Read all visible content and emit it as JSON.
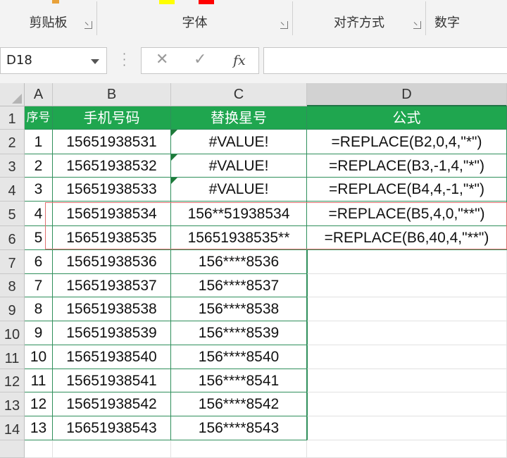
{
  "ribbon": {
    "groups": [
      {
        "label": "剪贴板"
      },
      {
        "label": "字体"
      },
      {
        "label": "对齐方式"
      },
      {
        "label": "数字"
      }
    ],
    "colors": {
      "highlight": "#ffff00",
      "font_color": "#ff0000"
    }
  },
  "formula_bar": {
    "name_box": "D18",
    "fx_label": "fx",
    "cancel_symbol": "✕",
    "enter_symbol": "✓",
    "formula": ""
  },
  "sheet": {
    "columns": [
      "A",
      "B",
      "C",
      "D"
    ],
    "selected_column": "D",
    "row_numbers": [
      "1",
      "2",
      "3",
      "4",
      "5",
      "6",
      "7",
      "8",
      "9",
      "10",
      "11",
      "12",
      "13",
      "14",
      ""
    ],
    "header": [
      "序号",
      "手机号码",
      "替换星号",
      "公式"
    ],
    "rows": [
      [
        "1",
        "15651938531",
        "#VALUE!",
        "=REPLACE(B2,0,4,\"*\")"
      ],
      [
        "2",
        "15651938532",
        "#VALUE!",
        "=REPLACE(B3,-1,4,\"*\")"
      ],
      [
        "3",
        "15651938533",
        "#VALUE!",
        "=REPLACE(B4,4,-1,\"*\")"
      ],
      [
        "4",
        "15651938534",
        "156**51938534",
        "=REPLACE(B5,4,0,\"**\")"
      ],
      [
        "5",
        "15651938535",
        "15651938535**",
        "=REPLACE(B6,40,4,\"**\")"
      ],
      [
        "6",
        "15651938536",
        "156****8536",
        ""
      ],
      [
        "7",
        "15651938537",
        "156****8537",
        ""
      ],
      [
        "8",
        "15651938538",
        "156****8538",
        ""
      ],
      [
        "9",
        "15651938539",
        "156****8539",
        ""
      ],
      [
        "10",
        "15651938540",
        "156****8540",
        ""
      ],
      [
        "11",
        "15651938541",
        "156****8541",
        ""
      ],
      [
        "12",
        "15651938542",
        "156****8542",
        ""
      ],
      [
        "13",
        "15651938543",
        "156****8543",
        ""
      ]
    ],
    "colors": {
      "header_fill": "#1fa64f",
      "border": "#2f8f5b",
      "error_flag": "#1e7a3a",
      "highlight_box": "#e07070"
    }
  }
}
